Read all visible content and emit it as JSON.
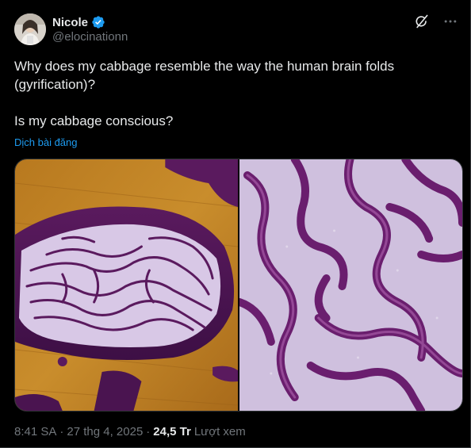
{
  "author": {
    "display_name": "Nicole",
    "handle": "@elocinationn",
    "verified": true,
    "verified_color": "#1d9bf0",
    "avatar_icon": "profile-photo"
  },
  "tweet": {
    "paragraphs": [
      "Why does my cabbage resemble the  way the human brain folds (gyrification)?",
      "Is my cabbage conscious?"
    ],
    "translate_label": "Dịch bài đăng"
  },
  "media": [
    {
      "icon": "cabbage-on-board-image"
    },
    {
      "icon": "cabbage-closeup-image"
    }
  ],
  "meta": {
    "time": "8:41 SA",
    "separator": "·",
    "date": "27 thg 4, 2025",
    "views_count": "24,5 Tr",
    "views_label": "Lượt xem"
  },
  "actions": {
    "grok_icon": "grok-icon",
    "more_icon": "more-icon"
  },
  "colors": {
    "background": "#000000",
    "text": "#e7e9ea",
    "secondary": "#71767b",
    "link": "#1d9bf0",
    "border": "#2f3336"
  }
}
